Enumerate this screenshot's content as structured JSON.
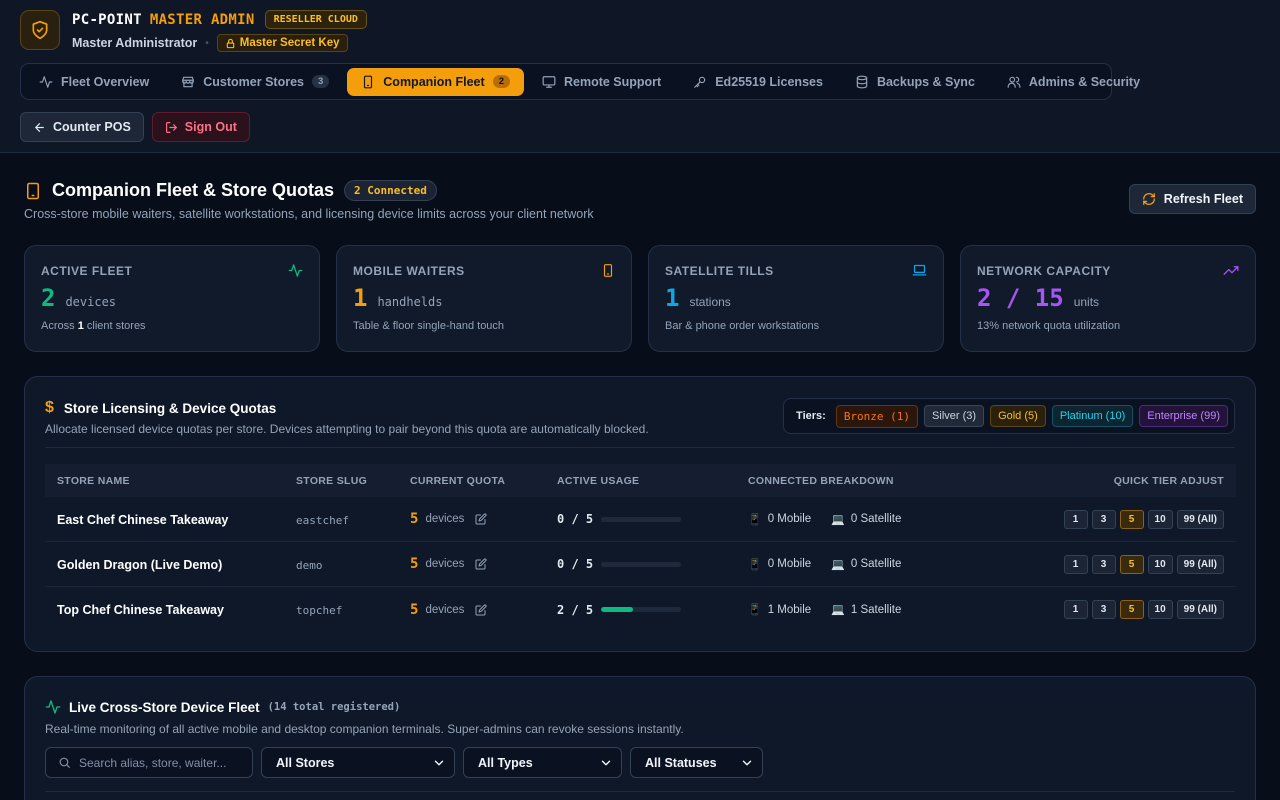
{
  "brand": {
    "name": "PC-POINT",
    "accent": "MASTER ADMIN",
    "badge": "RESELLER CLOUD",
    "role": "Master Administrator",
    "secret_key": "Master Secret Key"
  },
  "nav": [
    {
      "label": "Fleet Overview",
      "icon": "activity-icon"
    },
    {
      "label": "Customer Stores",
      "count": "3",
      "icon": "store-icon"
    },
    {
      "label": "Companion Fleet",
      "count": "2",
      "icon": "tablet-icon",
      "active": true
    },
    {
      "label": "Remote Support",
      "icon": "monitor-icon"
    },
    {
      "label": "Ed25519 Licenses",
      "icon": "key-icon"
    },
    {
      "label": "Backups & Sync",
      "icon": "database-icon"
    },
    {
      "label": "Admins & Security",
      "icon": "users-icon"
    }
  ],
  "actions": {
    "counter": "Counter POS",
    "signout": "Sign Out"
  },
  "page": {
    "title": "Companion Fleet & Store Quotas",
    "badge": "2 Connected",
    "subtitle": "Cross-store mobile waiters, satellite workstations, and licensing device limits across your client network",
    "refresh": "Refresh Fleet"
  },
  "stats": [
    {
      "label": "ACTIVE FLEET",
      "value": "2",
      "unit": "devices",
      "desc_pre": "Across ",
      "desc_bold": "1",
      "desc_post": " client stores",
      "color": "#10b981",
      "icon": "activity-icon"
    },
    {
      "label": "MOBILE WAITERS",
      "value": "1",
      "unit": "handhelds",
      "desc": "Table & floor single-hand touch",
      "color": "#f59e0b",
      "icon": "smartphone-icon"
    },
    {
      "label": "SATELLITE TILLS",
      "value": "1",
      "unit": "stations",
      "desc": "Bar & phone order workstations",
      "color": "#0ea5e9",
      "icon": "laptop-icon"
    },
    {
      "label": "NETWORK CAPACITY",
      "value": "2 / 15",
      "unit": "units",
      "desc": "13% network quota utilization",
      "color": "#a855f7",
      "icon": "trending-up-icon"
    }
  ],
  "quotas": {
    "title": "Store Licensing & Device Quotas",
    "subtitle": "Allocate licensed device quotas per store. Devices attempting to pair beyond this quota are automatically blocked.",
    "tiers_label": "Tiers:",
    "tiers": [
      "Bronze (1)",
      "Silver (3)",
      "Gold (5)",
      "Platinum (10)",
      "Enterprise (99)"
    ],
    "headers": [
      "STORE NAME",
      "STORE SLUG",
      "CURRENT QUOTA",
      "ACTIVE USAGE",
      "CONNECTED BREAKDOWN",
      "QUICK TIER ADJUST"
    ],
    "quota_unit": "devices",
    "adjust_options": [
      "1",
      "3",
      "5",
      "10",
      "99 (All)"
    ],
    "rows": [
      {
        "name": "East Chef Chinese Takeaway",
        "slug": "eastchef",
        "quota": "5",
        "usage": "0 / 5",
        "usage_fraction": 0,
        "mobile": "0 Mobile",
        "satellite": "0 Satellite",
        "active_tier": "5"
      },
      {
        "name": "Golden Dragon (Live Demo)",
        "slug": "demo",
        "quota": "5",
        "usage": "0 / 5",
        "usage_fraction": 0,
        "mobile": "0 Mobile",
        "satellite": "0 Satellite",
        "active_tier": "5"
      },
      {
        "name": "Top Chef Chinese Takeaway",
        "slug": "topchef",
        "quota": "5",
        "usage": "2 / 5",
        "usage_fraction": 0.4,
        "mobile": "1 Mobile",
        "satellite": "1 Satellite",
        "active_tier": "5"
      }
    ]
  },
  "fleet": {
    "title": "Live Cross-Store Device Fleet",
    "count": "(14 total registered)",
    "subtitle": "Real-time monitoring of all active mobile and desktop companion terminals. Super-admins can revoke sessions instantly.",
    "search_placeholder": "Search alias, store, waiter...",
    "filters": [
      "All Stores",
      "All Types",
      "All Statuses"
    ]
  }
}
